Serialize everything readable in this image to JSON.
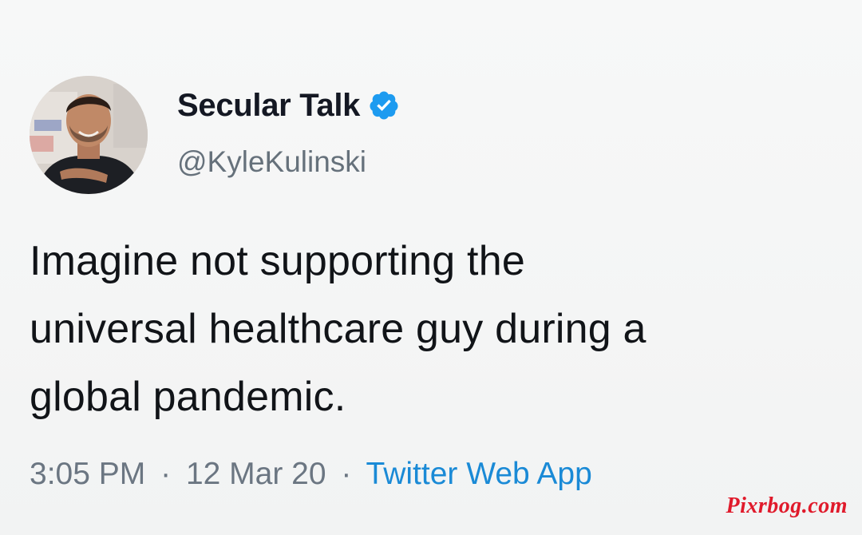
{
  "author": {
    "display_name": "Secular Talk",
    "handle": "@KyleKulinski",
    "verified": true,
    "avatar_icon": "profile-photo",
    "verified_icon": "verified-badge-icon"
  },
  "tweet": {
    "lines": [
      "Imagine not supporting the",
      "universal healthcare guy during a",
      "global pandemic."
    ]
  },
  "meta": {
    "time": "3:05 PM",
    "separator": "·",
    "date": "12 Mar 20",
    "source": "Twitter Web App"
  },
  "watermark": "Pixrbog.com",
  "colors": {
    "verified_blue": "#1d9bf0",
    "source_link": "#1a8ad6",
    "watermark_red": "#e01a2b",
    "text": "#111418",
    "muted": "#66717b"
  }
}
